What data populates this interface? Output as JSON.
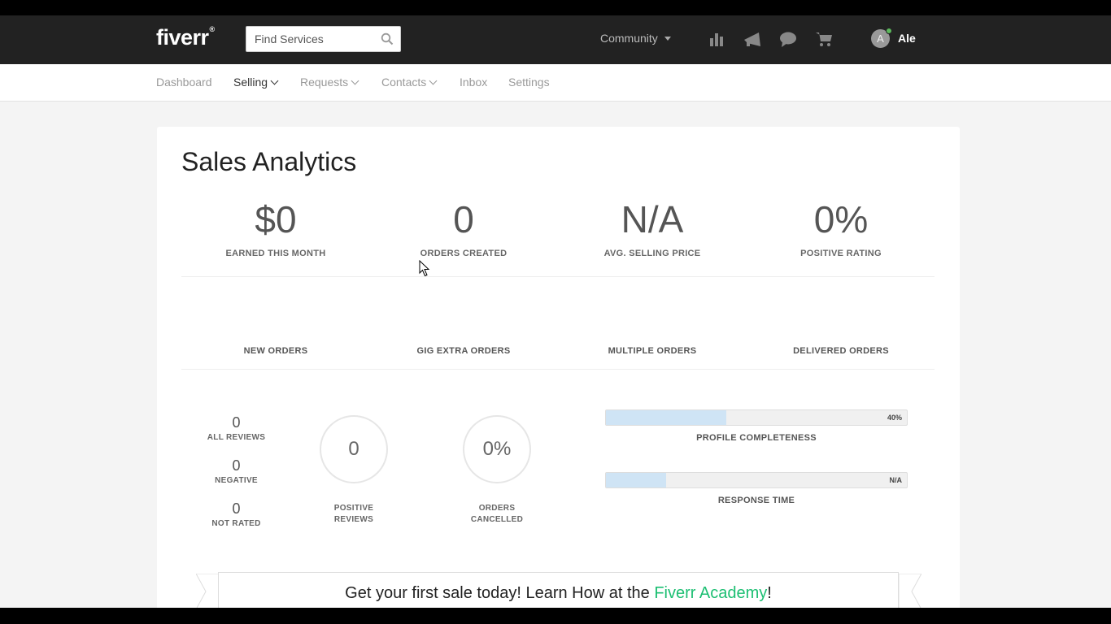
{
  "header": {
    "logo_text": "fiverr",
    "logo_mark": "®",
    "search_placeholder": "Find Services",
    "community_label": "Community",
    "icons": [
      "bar-chart-icon",
      "megaphone-icon",
      "chat-bubble-icon",
      "shopping-cart-icon"
    ],
    "avatar_initial": "A",
    "username": "Ale",
    "online_color": "#5cb85c"
  },
  "subnav": {
    "items": [
      {
        "label": "Dashboard",
        "dropdown": false,
        "active": false
      },
      {
        "label": "Selling",
        "dropdown": true,
        "active": true
      },
      {
        "label": "Requests",
        "dropdown": true,
        "active": false
      },
      {
        "label": "Contacts",
        "dropdown": true,
        "active": false
      },
      {
        "label": "Inbox",
        "dropdown": false,
        "active": false
      },
      {
        "label": "Settings",
        "dropdown": false,
        "active": false
      }
    ]
  },
  "analytics": {
    "title": "Sales Analytics",
    "stats": [
      {
        "value": "$0",
        "caption": "EARNED THIS MONTH"
      },
      {
        "value": "0",
        "caption": "ORDERS CREATED"
      },
      {
        "value": "N/A",
        "caption": "AVG. SELLING PRICE"
      },
      {
        "value": "0%",
        "caption": "POSITIVE RATING"
      }
    ],
    "order_types": [
      "NEW ORDERS",
      "GIG EXTRA ORDERS",
      "MULTIPLE ORDERS",
      "DELIVERED ORDERS"
    ],
    "reviews": [
      {
        "value": "0",
        "label": "ALL REVIEWS"
      },
      {
        "value": "0",
        "label": "NEGATIVE"
      },
      {
        "value": "0",
        "label": "NOT RATED"
      }
    ],
    "circles": [
      {
        "value": "0",
        "label_line1": "POSITIVE",
        "label_line2": "REVIEWS"
      },
      {
        "value": "0%",
        "label_line1": "ORDERS",
        "label_line2": "CANCELLED"
      }
    ],
    "bars": [
      {
        "value_text": "40%",
        "fraction": 0.4,
        "label": "PROFILE COMPLETENESS"
      },
      {
        "value_text": "N/A",
        "fraction": 0.2,
        "label": "RESPONSE TIME"
      }
    ]
  },
  "banner": {
    "text_before": "Get your first sale today! Learn How at the ",
    "link_text": "Fiverr Academy",
    "text_after": "!",
    "link_color": "#1dbf73"
  }
}
